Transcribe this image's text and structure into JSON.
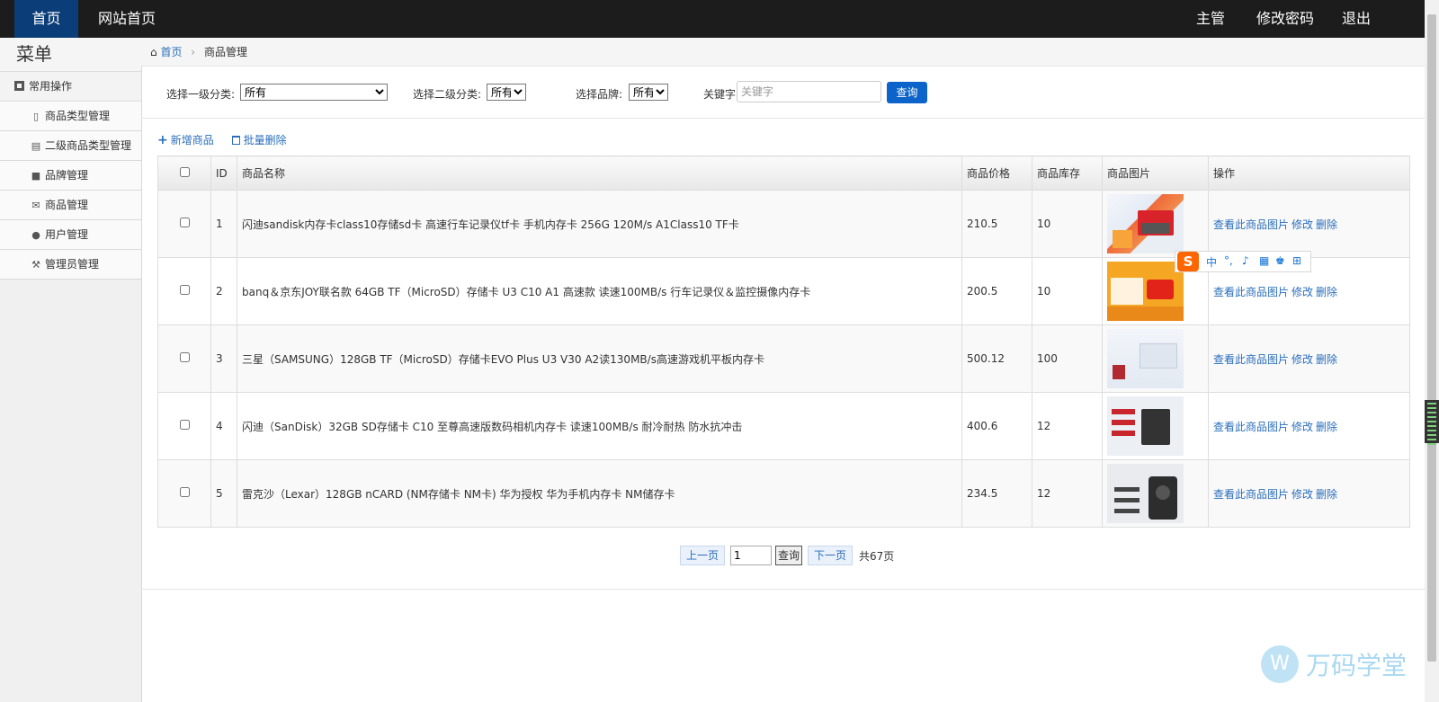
{
  "topbar": {
    "home": "首页",
    "site_home": "网站首页",
    "user": "主管",
    "change_password": "修改密码",
    "logout": "退出"
  },
  "sidebar": {
    "title": "菜单",
    "group": "常用操作",
    "items": [
      {
        "label": "商品类型管理",
        "icon": "file-icon"
      },
      {
        "label": "二级商品类型管理",
        "icon": "list-icon"
      },
      {
        "label": "品牌管理",
        "icon": "truck-icon"
      },
      {
        "label": "商品管理",
        "icon": "envelope-icon"
      },
      {
        "label": "用户管理",
        "icon": "comment-icon"
      },
      {
        "label": "管理员管理",
        "icon": "wrench-icon"
      }
    ]
  },
  "breadcrumb": {
    "home": "首页",
    "current": "商品管理"
  },
  "filter": {
    "cat1_label": "选择一级分类:",
    "cat1_value": "所有",
    "cat2_label": "选择二级分类:",
    "cat2_value": "所有",
    "brand_label": "选择品牌:",
    "brand_value": "所有",
    "keyword_label": "关键字:",
    "keyword_placeholder": "关键字",
    "query_button": "查询"
  },
  "actions": {
    "add": "新增商品",
    "batch_delete": "批量删除"
  },
  "table": {
    "headers": {
      "id": "ID",
      "name": "商品名称",
      "price": "商品价格",
      "stock": "商品库存",
      "image": "商品图片",
      "ops": "操作"
    },
    "ops": {
      "view_image": "查看此商品图片",
      "edit": "修改",
      "delete": "删除"
    },
    "rows": [
      {
        "id": "1",
        "name": "闪迪sandisk内存卡class10存储sd卡 高速行车记录仪tf卡 手机内存卡 256G 120M/s A1Class10 TF卡",
        "price": "210.5",
        "stock": "10"
      },
      {
        "id": "2",
        "name": " banq＆京东JOY联名款 64GB TF（MicroSD）存储卡 U3 C10 A1 高速款 读速100MB/s 行车记录仪＆监控摄像内存卡",
        "price": "200.5",
        "stock": "10"
      },
      {
        "id": "3",
        "name": "三星（SAMSUNG）128GB TF（MicroSD）存储卡EVO Plus U3 V30 A2读130MB/s高速游戏机平板内存卡",
        "price": "500.12",
        "stock": "100"
      },
      {
        "id": "4",
        "name": "闪迪（SanDisk）32GB SD存储卡 C10 至尊高速版数码相机内存卡 读速100MB/s 耐冷耐热 防水抗冲击",
        "price": "400.6",
        "stock": "12"
      },
      {
        "id": "5",
        "name": "雷克沙（Lexar）128GB nCARD (NM存储卡 NM卡) 华为授权 华为手机内存卡 NM储存卡",
        "price": "234.5",
        "stock": "12"
      }
    ]
  },
  "pager": {
    "prev": "上一页",
    "page": "1",
    "go": "查询",
    "next": "下一页",
    "total": "共67页"
  },
  "ime": {
    "lang": "中"
  },
  "watermark": "万码学堂"
}
